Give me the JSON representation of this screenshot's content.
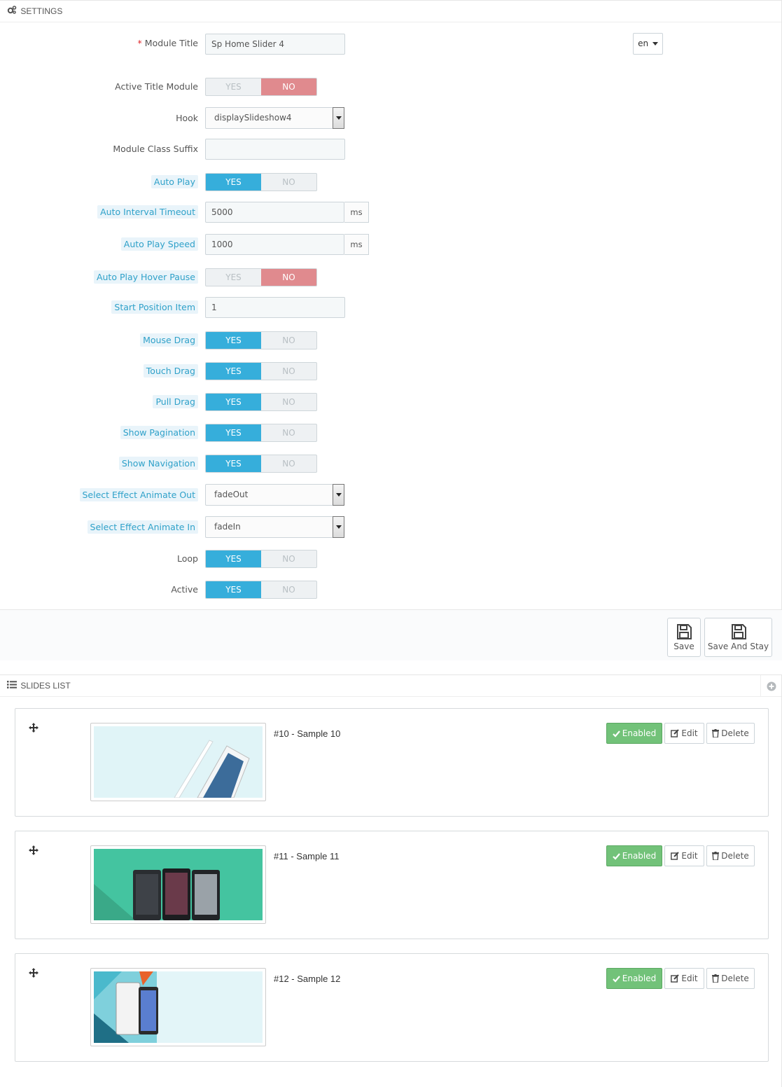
{
  "settings": {
    "heading": "SETTINGS",
    "heading_icon": "cogs-icon",
    "lang_button": "en",
    "fields": {
      "module_title": {
        "label": "Module Title",
        "required_mark": "*",
        "value": "Sp Home Slider 4"
      },
      "active_title_module": {
        "label": "Active Title Module",
        "yes": "YES",
        "no": "NO",
        "selected": "NO"
      },
      "hook": {
        "label": "Hook",
        "value": "displaySlideshow4"
      },
      "module_class_suffix": {
        "label": "Module Class Suffix",
        "value": ""
      },
      "auto_play": {
        "label": "Auto Play",
        "yes": "YES",
        "no": "NO",
        "selected": "YES"
      },
      "auto_interval_timeout": {
        "label": "Auto Interval Timeout",
        "value": "5000",
        "unit": "ms"
      },
      "auto_play_speed": {
        "label": "Auto Play Speed",
        "value": "1000",
        "unit": "ms"
      },
      "auto_play_hover_pause": {
        "label": "Auto Play Hover Pause",
        "yes": "YES",
        "no": "NO",
        "selected": "NO"
      },
      "start_position_item": {
        "label": "Start Position Item",
        "value": "1"
      },
      "mouse_drag": {
        "label": "Mouse Drag",
        "yes": "YES",
        "no": "NO",
        "selected": "YES"
      },
      "touch_drag": {
        "label": "Touch Drag",
        "yes": "YES",
        "no": "NO",
        "selected": "YES"
      },
      "pull_drag": {
        "label": "Pull Drag",
        "yes": "YES",
        "no": "NO",
        "selected": "YES"
      },
      "show_pagination": {
        "label": "Show Pagination",
        "yes": "YES",
        "no": "NO",
        "selected": "YES"
      },
      "show_navigation": {
        "label": "Show Navigation",
        "yes": "YES",
        "no": "NO",
        "selected": "YES"
      },
      "animate_out": {
        "label": "Select Effect Animate Out",
        "value": "fadeOut"
      },
      "animate_in": {
        "label": "Select Effect Animate In",
        "value": "fadeIn"
      },
      "loop": {
        "label": "Loop",
        "yes": "YES",
        "no": "NO",
        "selected": "YES"
      },
      "active": {
        "label": "Active",
        "yes": "YES",
        "no": "NO",
        "selected": "YES"
      }
    },
    "save_label": "Save",
    "save_stay_label": "Save And Stay"
  },
  "slides": {
    "heading": "SLIDES LIST",
    "heading_icon": "list-icon",
    "items": [
      {
        "title": "#10 - Sample 10",
        "status": "Enabled",
        "edit": "Edit",
        "delete": "Delete"
      },
      {
        "title": "#11 - Sample 11",
        "status": "Enabled",
        "edit": "Edit",
        "delete": "Delete"
      },
      {
        "title": "#12 - Sample 12",
        "status": "Enabled",
        "edit": "Edit",
        "delete": "Delete"
      }
    ]
  },
  "colors": {
    "switch_yes": "#36aedb",
    "switch_no": "#e08a8e",
    "enabled": "#72c279",
    "hint_label": "#2fa1c9"
  }
}
